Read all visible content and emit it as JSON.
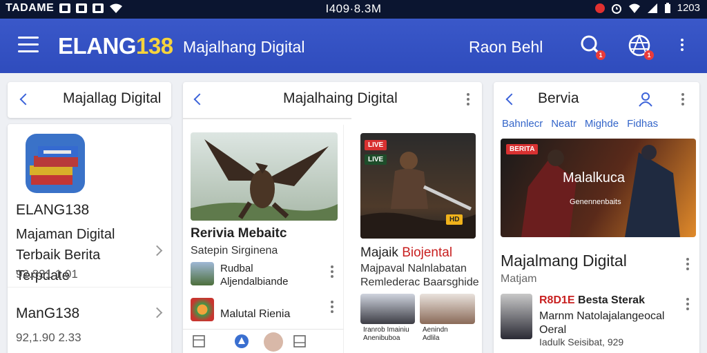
{
  "status_bar": {
    "carrier": "TADAME",
    "center": "I409·8.3M",
    "time": "1203"
  },
  "app_bar": {
    "brand_main": "ELANG",
    "brand_accent": "138",
    "subtitle": "Majalhang Digital",
    "link": "Raon Behl",
    "search_badge": "1",
    "globe_badge": "1"
  },
  "column1": {
    "header_title": "Majallag Digital",
    "app_name": "ELANG138",
    "app_desc": "Majaman Digital Terbaik Berita Terpdate",
    "app_meta": "92.331 1.01",
    "item2_name": "ManG138",
    "item2_meta": "92,1.90 2.33"
  },
  "column2": {
    "header_title": "Majalhaing Digital",
    "card1_title": "Rerivia Mebaitc",
    "card1_sub": "Satepin Sirginena",
    "row1_line1": "Rudbal",
    "row1_line2": "Aljendalbiande",
    "row2_text": "Malutal Rienia",
    "card2_title_a": "Majaik ",
    "card2_title_b": "Biojental",
    "card2_line1": "Majpaval Nalnlabatan",
    "card2_line2": "Remlederac Baarsghide",
    "card2_tag1": "LIVE",
    "card2_tag2": "LIVE",
    "card2_badge": "HD",
    "card2_cap1": "Iranrob Imainiu\nAnenibuboa",
    "card2_cap2": "Aenindn\nAdlila"
  },
  "column3": {
    "header_title": "Bervia",
    "tabs": [
      "Bahnlecr",
      "Neatr",
      "Mighde",
      "Fidhas"
    ],
    "hero_tag": "BERITA",
    "hero_text1": "Malalkuca",
    "hero_text2": "Genennenbaits",
    "headline": "Majalmang Digital",
    "headline_sub": "Matjam",
    "row_title_red": "R8D1E",
    "row_title_rest": " Besta Sterak",
    "row_body": "Marnm Natolajalangeocal Oeral",
    "row_meta": "Iadulk Seisibat, 929"
  },
  "colors": {
    "app_bar": "#2f4cbd",
    "accent_yellow": "#f6d33c",
    "link_blue": "#3b62d9",
    "alert_red": "#d83131"
  }
}
